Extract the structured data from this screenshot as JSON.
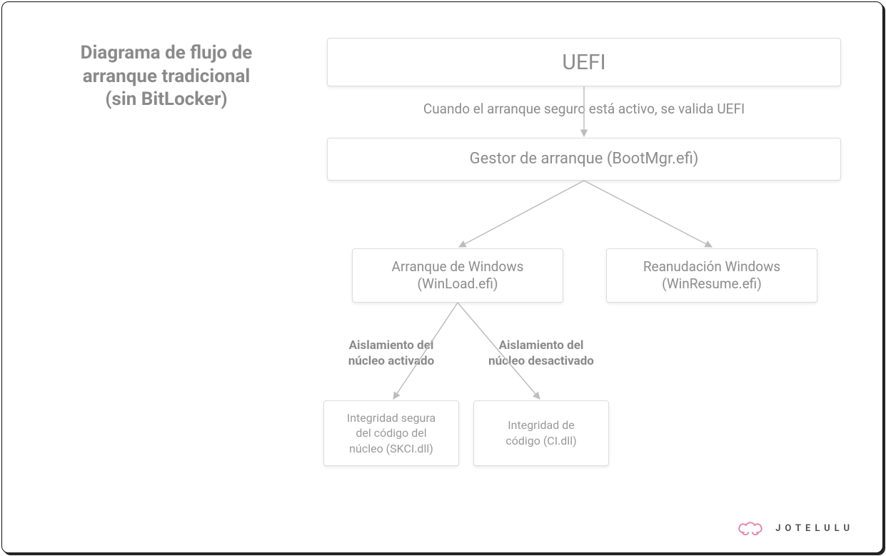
{
  "title": {
    "line1": "Diagrama de flujo de",
    "line2": "arranque tradicional",
    "line3": "(sin BitLocker)"
  },
  "nodes": {
    "uefi": "UEFI",
    "bootmgr": "Gestor de arranque (BootMgr.efi)",
    "winload_line1": "Arranque de Windows",
    "winload_line2": "(WinLoad.efi)",
    "winresume_line1": "Reanudación Windows",
    "winresume_line2": "(WinResume.efi)",
    "skci_line1": "Integridad segura",
    "skci_line2": "del código del",
    "skci_line3": "núcleo (SKCI.dll)",
    "ci_line1": "Integridad de",
    "ci_line2": "código (CI.dll)"
  },
  "edges": {
    "uefi_to_bootmgr": "Cuando el arranque seguro está activo, se valida UEFI",
    "core_on_line1": "Aislamiento del",
    "core_on_line2": "núcleo activado",
    "core_off_line1": "Aislamiento del",
    "core_off_line2": "núcleo desactivado"
  },
  "branding": {
    "name": "JOTELULU"
  },
  "colors": {
    "box_border": "#dcdcdc",
    "text_muted": "#8c8c8c",
    "arrow": "#bdbdbd",
    "brand_pink": "#e28bb0"
  }
}
